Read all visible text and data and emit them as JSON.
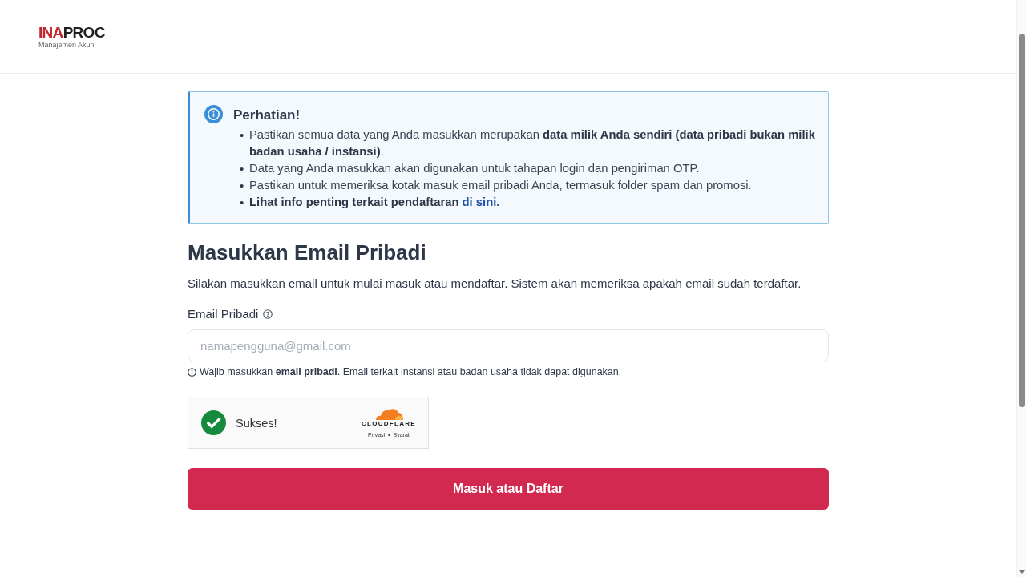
{
  "header": {
    "logo": {
      "brand_red": "INA",
      "brand_dark": "PROC",
      "subtitle": "Manajemen Akun"
    }
  },
  "alert": {
    "title": "Perhatian!",
    "items": [
      {
        "marker": "•",
        "text": "Pastikan semua data yang Anda masukkan merupakan **data milik Anda sendiri (data pribadi bukan milik badan usaha / instansi)**."
      },
      {
        "marker": "•",
        "text": "Data yang Anda masukkan akan digunakan untuk tahapan login dan pengiriman OTP."
      },
      {
        "marker": "•",
        "text": "Pastikan untuk memeriksa kotak masuk email pribadi Anda, termasuk folder spam dan promosi."
      },
      {
        "marker": "•",
        "text": "**Lihat info penting terkait pendaftaran**",
        "link": "di sini."
      }
    ]
  },
  "form": {
    "heading": "Masukkan Email Pribadi",
    "description": "Silakan masukkan email untuk mulai masuk atau mendaftar. Sistem akan memeriksa apakah email sudah terdaftar.",
    "email_field": {
      "label": "Email Pribadi",
      "placeholder": "namapengguna@gmail.com",
      "hint": "Wajib masukkan **email pribadi**. Email terkait instansi atau badan usaha tidak dapat digunakan."
    },
    "captcha": {
      "verified": true,
      "status": "Sukses!",
      "provider": "CLOUDFLARE",
      "links": [
        "Privasi",
        "Syarat"
      ],
      "link_separator": "•"
    },
    "submit_button": "Masuk atau Daftar"
  }
}
